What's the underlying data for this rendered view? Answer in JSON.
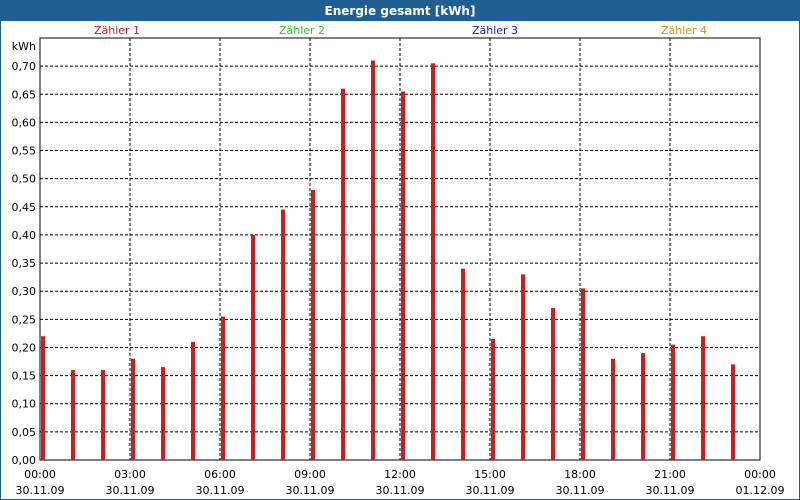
{
  "window": {
    "title": "Energie gesamt [kWh]"
  },
  "legend": [
    {
      "label": "Zähler 1",
      "color": "#cc1e1e"
    },
    {
      "label": "Zähler 2",
      "color": "#2ec82e"
    },
    {
      "label": "Zähler 3",
      "color": "#1e1ea0"
    },
    {
      "label": "Zähler 4",
      "color": "#d78c1e"
    }
  ],
  "chart_data": {
    "type": "bar",
    "title": "Energie gesamt [kWh]",
    "ylabel": "kWh",
    "ylim": [
      0,
      0.75
    ],
    "yticks": [
      "0,00",
      "0,05",
      "0,10",
      "0,15",
      "0,20",
      "0,25",
      "0,30",
      "0,35",
      "0,40",
      "0,45",
      "0,50",
      "0,55",
      "0,60",
      "0,65",
      "0,70"
    ],
    "xtick_times": [
      "00:00",
      "03:00",
      "06:00",
      "09:00",
      "12:00",
      "15:00",
      "18:00",
      "21:00",
      "00:00"
    ],
    "xtick_dates": [
      "30.11.09",
      "30.11.09",
      "30.11.09",
      "30.11.09",
      "30.11.09",
      "30.11.09",
      "30.11.09",
      "30.11.09",
      "01.12.09"
    ],
    "grid": true,
    "bar_color": "#cc1e1e",
    "hours": [
      0,
      1,
      2,
      3,
      4,
      5,
      6,
      7,
      8,
      9,
      10,
      11,
      12,
      13,
      14,
      15,
      16,
      17,
      18,
      19,
      20,
      21,
      22,
      23
    ],
    "series": [
      {
        "name": "Zähler 1",
        "values": [
          0.22,
          0.16,
          0.16,
          0.18,
          0.165,
          0.21,
          0.255,
          0.4,
          0.445,
          0.48,
          0.66,
          0.71,
          0.655,
          0.705,
          0.34,
          0.215,
          0.33,
          0.27,
          0.305,
          0.18,
          0.19,
          0.205,
          0.22,
          0.17
        ]
      }
    ]
  }
}
